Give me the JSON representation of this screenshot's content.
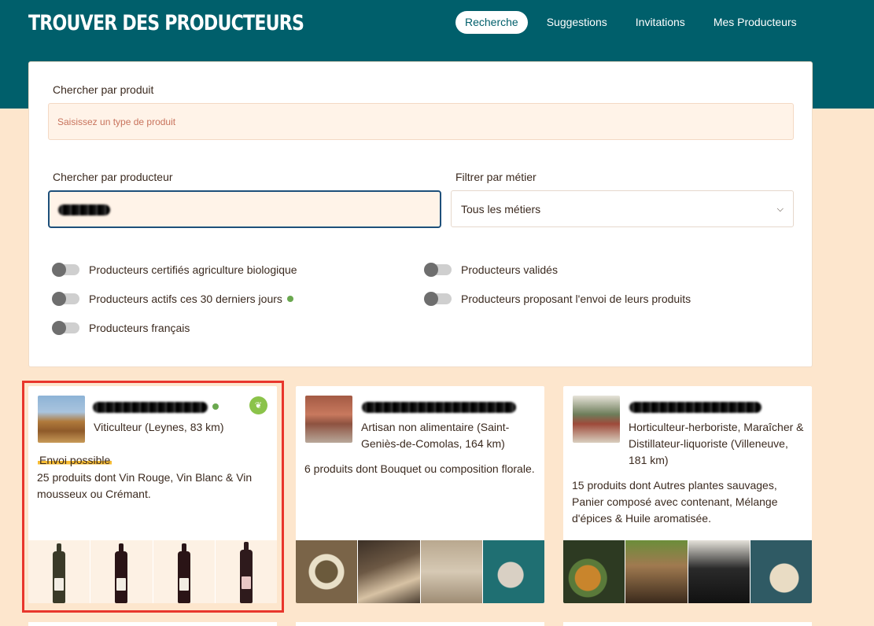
{
  "header": {
    "title": "TROUVER DES PRODUCTEURS",
    "nav": [
      "Recherche",
      "Suggestions",
      "Invitations",
      "Mes Producteurs"
    ]
  },
  "search": {
    "product_label": "Chercher par produit",
    "product_placeholder": "Saisissez un type de produit",
    "producer_label": "Chercher par producteur",
    "job_label": "Filtrer par métier",
    "job_selected": "Tous les métiers"
  },
  "filters": [
    "Producteurs certifiés agriculture biologique",
    "Producteurs actifs ces 30 derniers jours",
    "Producteurs français",
    "Producteurs validés",
    "Producteurs proposant l'envoi de leurs produits"
  ],
  "cards": [
    {
      "subtitle": "Viticulteur (Leynes, 83 km)",
      "badge": "Envoi possible",
      "description": "25 produits dont Vin Rouge, Vin Blanc & Vin mousseux ou Crémant."
    },
    {
      "subtitle": "Artisan non alimentaire (Saint-Geniès-de-Comolas, 164 km)",
      "description": "6 produits dont Bouquet ou composition florale."
    },
    {
      "subtitle": "Horticulteur-herboriste, Maraîcher & Distillateur-liquoriste (Villeneuve, 181 km)",
      "description": "15 produits dont Autres plantes sauvages, Panier composé avec contenant, Mélange d'épices & Huile aromatisée."
    }
  ],
  "colors": {
    "header": "#005f6b",
    "background": "#fde6cd",
    "highlight": "#e8362c",
    "active_dot": "#6aa84f"
  }
}
